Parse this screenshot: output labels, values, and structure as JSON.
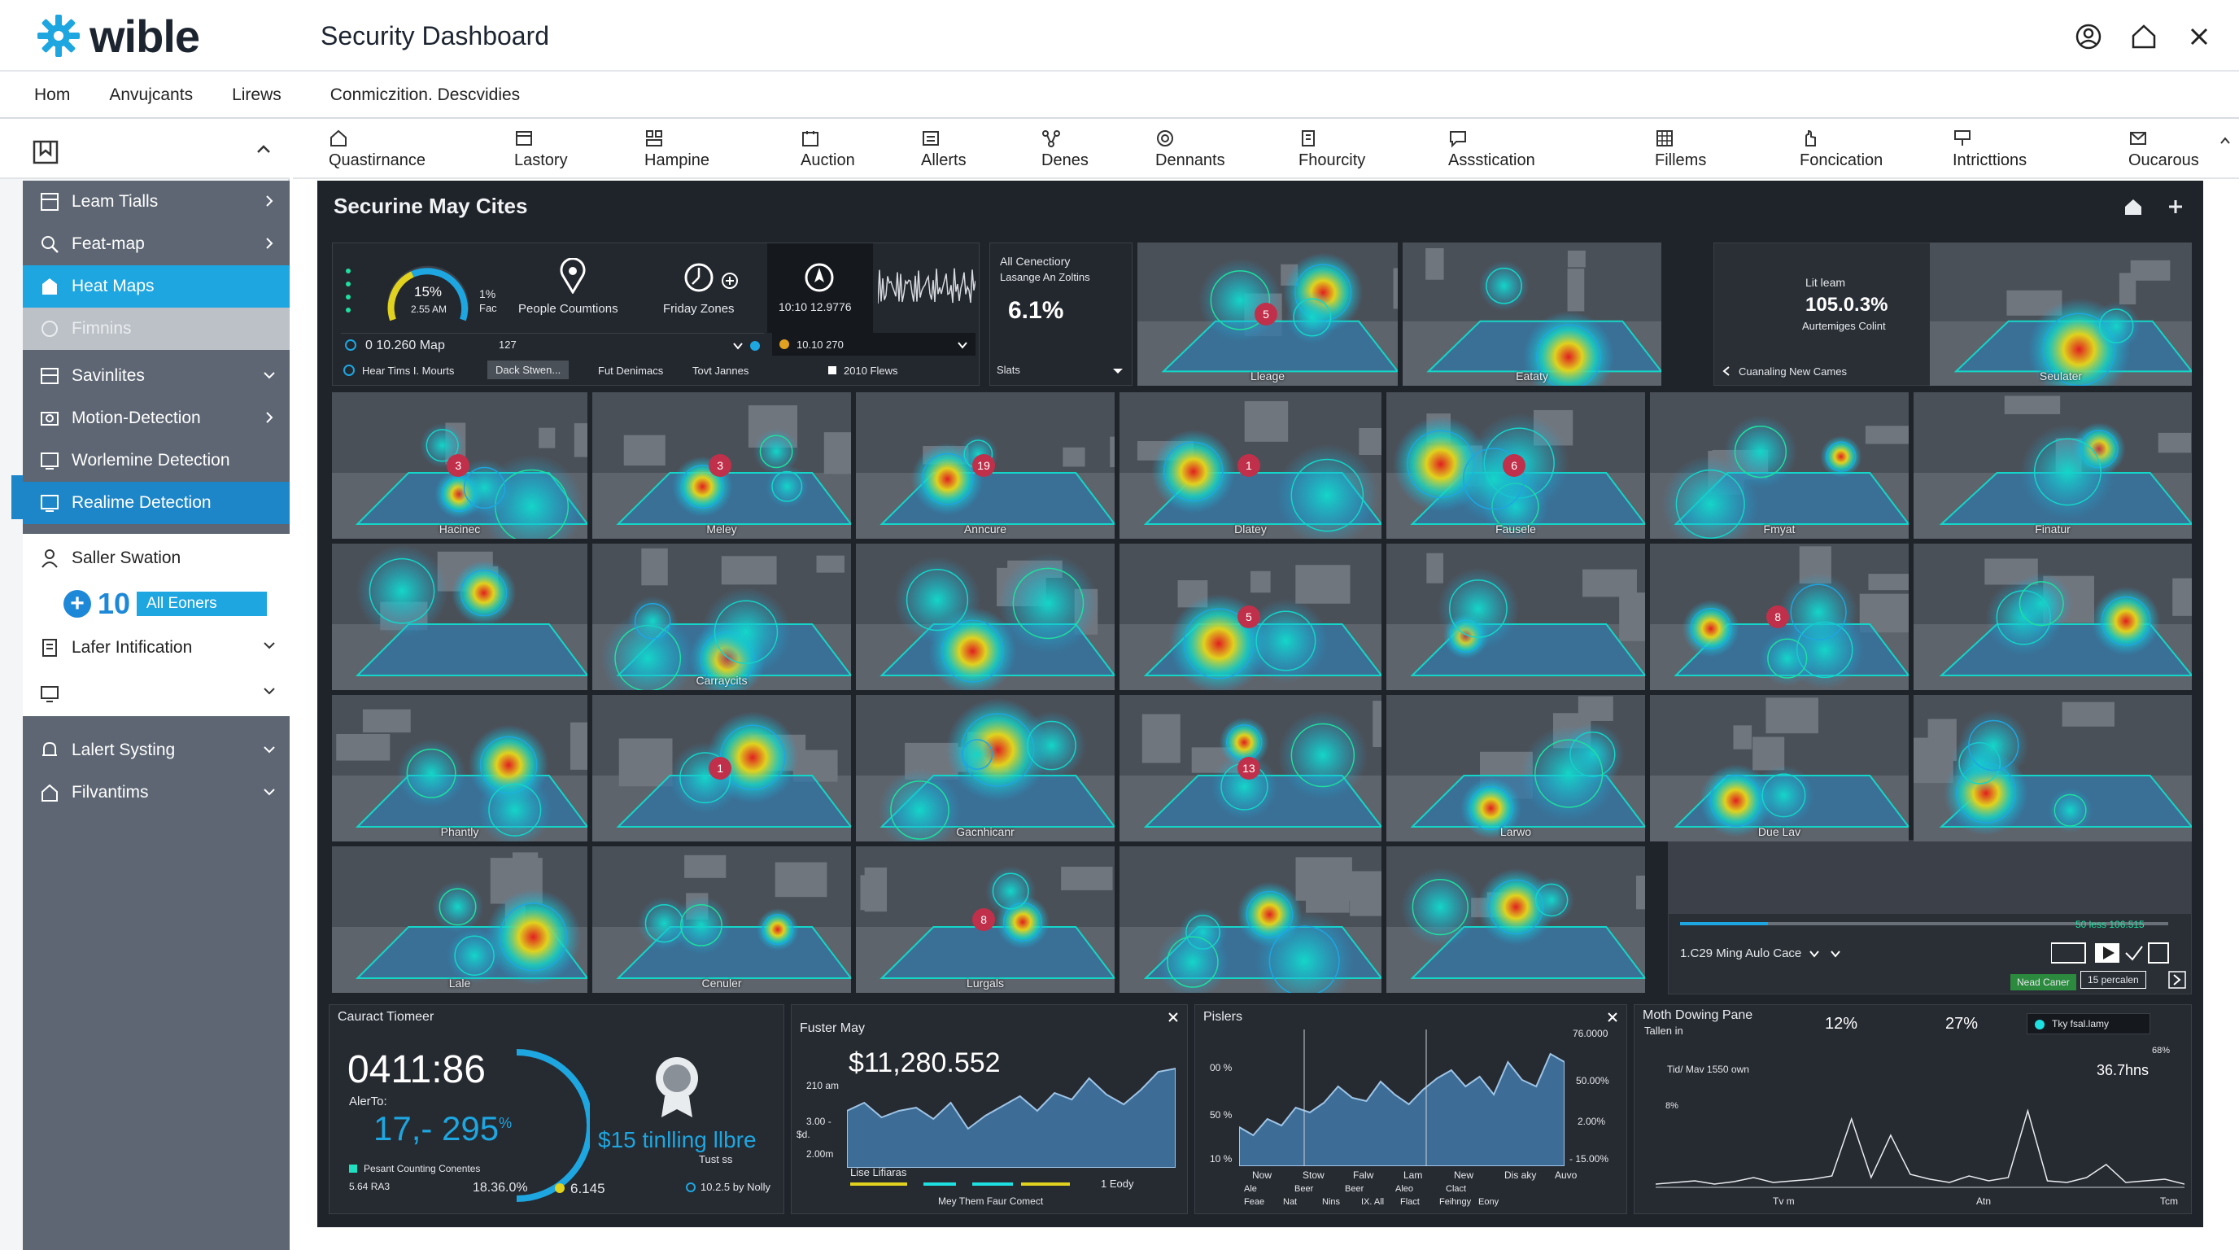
{
  "brand": {
    "name": "wible"
  },
  "header": {
    "title": "Security Dashboard"
  },
  "nav": {
    "items": [
      "Hom",
      "Anvujcants",
      "Lirews",
      "Conmiczition. Descvidies"
    ]
  },
  "sidebar": {
    "items": [
      {
        "label": "Leam Tialls",
        "icon": "grid-icon"
      },
      {
        "label": "Feat-map",
        "icon": "search-icon"
      },
      {
        "label": "Heat Maps",
        "icon": "map-icon"
      },
      {
        "label": "Fimnins",
        "icon": "circle-icon"
      },
      {
        "label": "Savinlites",
        "icon": "layers-icon"
      },
      {
        "label": "Motion-Detection",
        "icon": "camera-icon"
      },
      {
        "label": "Worlemine Detection",
        "icon": "screen-icon"
      },
      {
        "label": "Realime Detection",
        "icon": "screen-icon"
      },
      {
        "label": "Saller Swation",
        "icon": "person-icon"
      },
      {
        "label": "Lafer Intification",
        "icon": "document-icon"
      },
      {
        "label": "",
        "icon": "monitor-icon"
      },
      {
        "label": "Lalert Systing",
        "icon": "bell-icon"
      },
      {
        "label": "Filvantims",
        "icon": "home-icon"
      }
    ],
    "badge": {
      "plus": "+",
      "count": "10",
      "label": "All Eoners"
    }
  },
  "tools": [
    "Quastirnance",
    "Lastory",
    "Hampine",
    "Auction",
    "Allerts",
    "Denes",
    "Dennants",
    "Fhourcity",
    "Assstication",
    "Fillems",
    "Foncication",
    "Intricttions",
    "Oucarous"
  ],
  "main": {
    "title": "Securine May Cites",
    "stats_panel": {
      "gauge_pct": "15%",
      "gauge_time": "2.55 AM",
      "gauge_side": "1%",
      "gauge_side2": "Fac",
      "people": "People Coumtions",
      "zones": "Friday Zones",
      "time_value": "10:10 12.9776",
      "map_row": "0 10.260 Map",
      "map_val": "127",
      "map_right": "10.10 270",
      "filters": [
        "Hear Tims I. Mourts",
        "Dack Stwen...",
        "Fut Denimacs",
        "Tovt Jannes",
        "2010 Flews"
      ]
    },
    "conn_tile": {
      "line1": "All Cenectiory",
      "line2": "Lasange An Zoltins",
      "value": "6.1%",
      "foot": "Slats"
    },
    "lit_tile": {
      "line1": "Lit leam",
      "value": "105.0.3%",
      "line2": "Aurtemiges Colint",
      "foot": "Cuanaling New Cames"
    },
    "cameras": [
      {
        "label": "Lleage",
        "num": "5"
      },
      {
        "label": "Eataty"
      },
      {
        "label": "Seulater"
      },
      {
        "label": "Hacinec",
        "num": "3"
      },
      {
        "label": "Meley",
        "num": "3"
      },
      {
        "label": "Anncure",
        "num": "19"
      },
      {
        "label": "Dlatey",
        "num": "1"
      },
      {
        "label": "Fausele",
        "num": "6"
      },
      {
        "label": "Fmyat"
      },
      {
        "label": "Finatur"
      },
      {
        "label": ""
      },
      {
        "label": "Carraycits"
      },
      {
        "label": ""
      },
      {
        "label": "",
        "num": "5"
      },
      {
        "label": ""
      },
      {
        "label": "",
        "num": "8"
      },
      {
        "label": ""
      },
      {
        "label": "Phantly"
      },
      {
        "label": "",
        "num": "1"
      },
      {
        "label": "Gacnhicanr"
      },
      {
        "label": "",
        "num": "13"
      },
      {
        "label": "Larwo"
      },
      {
        "label": "Due Lav"
      },
      {
        "label": ""
      },
      {
        "label": "Lale"
      },
      {
        "label": "Cenuler"
      },
      {
        "label": "Lurgals",
        "num": "8"
      },
      {
        "label": ""
      },
      {
        "label": ""
      }
    ],
    "player": {
      "status": "50 less 106.515",
      "location": "1.C29 Ming Aulo Cace",
      "tag1": "Nead Caner",
      "tag2": "15 percalen"
    }
  },
  "bottom": {
    "counter": {
      "title": "Cauract Tiomeer",
      "big": "0411:86",
      "sub": "AlerTo:",
      "pct": "17,- 295",
      "pct_suffix": "%",
      "legend1": "Pesant Counting Conentes",
      "legend2": "5.64 RA3",
      "val1": "18.36.0%",
      "val2": "6.145",
      "award_text": "$15 tinlling llbre",
      "award_sub": "Tust ss",
      "award_foot": "10.2.5 by Nolly"
    },
    "fuster": {
      "title": "Fuster May",
      "value": "$11,280.552",
      "y1": "210 am",
      "y2": "3.00 -",
      "y3": "2.00m",
      "legend": "Lise Lifiaras",
      "legend2": "1 Eody",
      "foot": "Mey Them Faur Comect",
      "yl": "$d."
    },
    "pislers": {
      "title": "Pislers",
      "ly": [
        "00 %",
        "50 %",
        "10 %"
      ],
      "ry": [
        "76.0000",
        "50.00%",
        "2.00%",
        "- 15.00%"
      ],
      "x": [
        "Now",
        "Stow",
        "Falw",
        "Lam",
        "New",
        "Dis aky",
        "Auvo"
      ],
      "legend": [
        "Ale",
        "Beer",
        "Beer",
        "Aleo",
        "Clact",
        "Feae",
        "Nat",
        "Nins",
        "IX. All",
        "Flact",
        "Feihngy",
        "Eony"
      ]
    },
    "moth": {
      "title": "Moth Dowing Pane",
      "sub": "Tallen in",
      "v1": "12%",
      "v2": "27%",
      "chip": "Tky fsal.lamy",
      "line": "Tid/ Mav 1550 own",
      "val": "36.7hns",
      "pct": "68%",
      "pct2": "8%",
      "x": [
        "Tv m",
        "Atn",
        "Tcm"
      ]
    }
  },
  "colors": {
    "accent": "#1ea6e0",
    "sidebar": "#5d6672",
    "dark": "#1f232a"
  }
}
